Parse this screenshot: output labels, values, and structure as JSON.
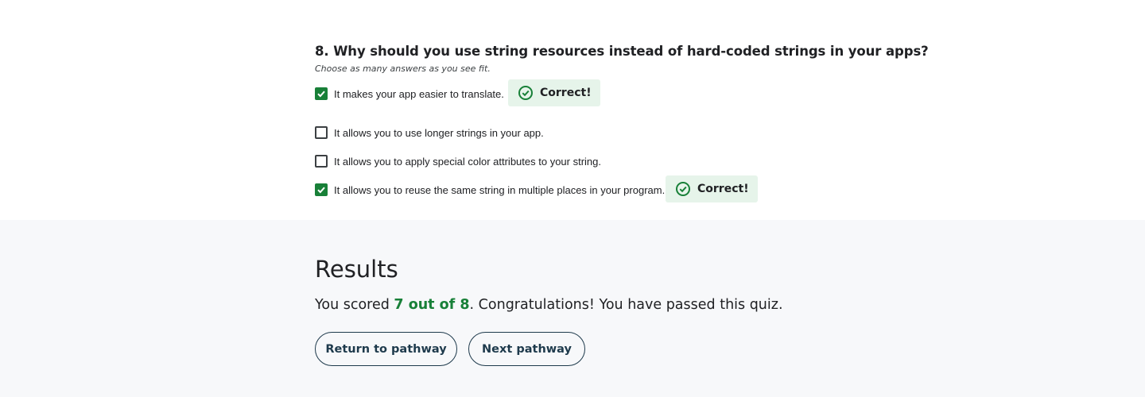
{
  "question": {
    "title": "8. Why should you use string resources instead of hard-coded strings in your apps?",
    "hint": "Choose as many answers as you see fit.",
    "options": [
      {
        "label": "It makes your app easier to translate.",
        "checked": true,
        "feedback": "Correct!"
      },
      {
        "label": "It allows you to use longer strings in your app.",
        "checked": false,
        "feedback": ""
      },
      {
        "label": "It allows you to apply special color attributes to your string.",
        "checked": false,
        "feedback": ""
      },
      {
        "label": "It allows you to reuse the same string in multiple places in your program.",
        "checked": true,
        "feedback": "Correct!"
      }
    ],
    "feedback_icon": "check-circle-icon"
  },
  "results": {
    "title": "Results",
    "prefix": "You scored ",
    "score": "7 out of 8",
    "suffix": ". Congratulations! You have passed this quiz.",
    "buttons": {
      "return_label": "Return to pathway",
      "next_label": "Next pathway"
    }
  },
  "colors": {
    "success_green": "#188038",
    "badge_bg": "#e6f4ea",
    "button_border": "#1e3a4c",
    "results_bg": "#f7f8fa"
  }
}
